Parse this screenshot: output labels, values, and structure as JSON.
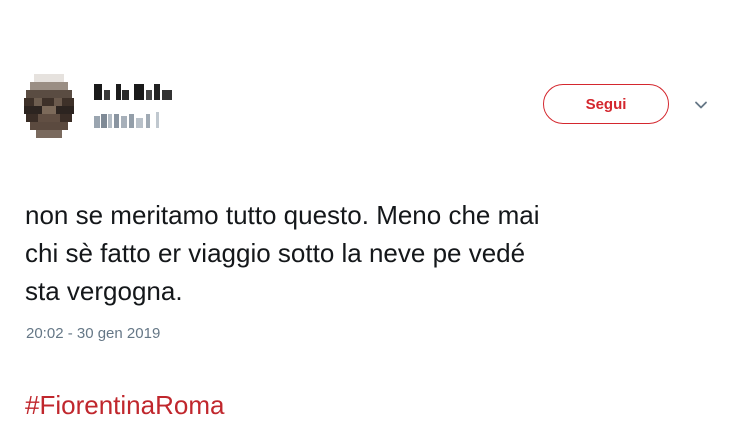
{
  "tweet": {
    "follow_label": "Segui",
    "text": "non se meritamo tutto questo. Meno che mai\nchi sè fatto er viaggio sotto la neve pe vedé\nsta vergogna.",
    "hashtag": "#FiorentinaRoma",
    "timestamp": "20:02 - 30 gen 2019"
  },
  "icons": {
    "more": "chevron-down-icon"
  },
  "colors": {
    "accent": "#d4272e",
    "hashtag": "#c0272d",
    "text": "#14171a",
    "muted": "#657786"
  }
}
